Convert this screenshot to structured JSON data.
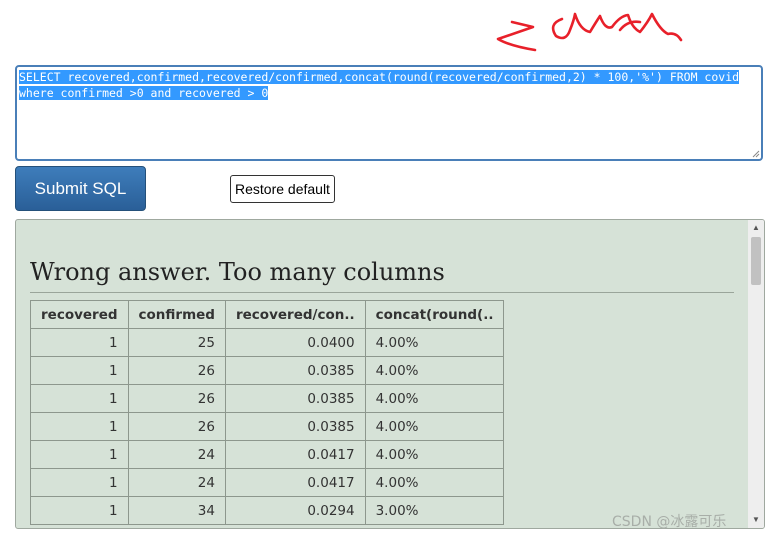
{
  "sql": {
    "line1": "SELECT recovered,confirmed,recovered/confirmed,concat(round(recovered/confirmed,2) * 100,'%') FROM covid",
    "line2": "where confirmed >0 and recovered > 0"
  },
  "buttons": {
    "submit": "Submit SQL",
    "restore": "Restore default"
  },
  "result": {
    "title": "Wrong answer. Too many columns",
    "columns": [
      "recovered",
      "confirmed",
      "recovered/con..",
      "concat(round(.."
    ],
    "rows": [
      [
        "1",
        "25",
        "0.0400",
        "4.00%"
      ],
      [
        "1",
        "26",
        "0.0385",
        "4.00%"
      ],
      [
        "1",
        "26",
        "0.0385",
        "4.00%"
      ],
      [
        "1",
        "26",
        "0.0385",
        "4.00%"
      ],
      [
        "1",
        "24",
        "0.0417",
        "4.00%"
      ],
      [
        "1",
        "24",
        "0.0417",
        "4.00%"
      ],
      [
        "1",
        "34",
        "0.0294",
        "3.00%"
      ]
    ]
  },
  "watermark": "CSDN @冰露可乐",
  "colors": {
    "annotation": "#e8202a",
    "selection": "#3399ff",
    "panel": "#d6e2d7",
    "submit": "#2a5f98"
  },
  "icons": [
    "scroll-up-icon",
    "scroll-down-icon",
    "resize-grip-icon"
  ]
}
